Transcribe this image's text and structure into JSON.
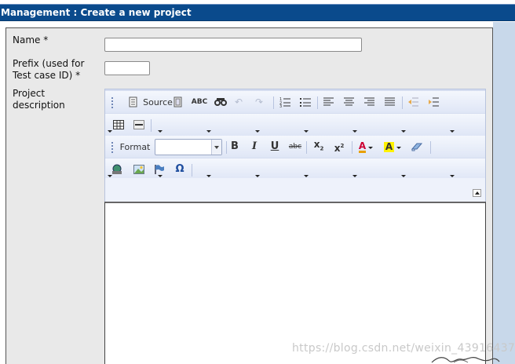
{
  "header": {
    "title": "Management : Create a new project"
  },
  "form": {
    "name_label": "Name *",
    "prefix_label_line1": "Prefix (used for",
    "prefix_label_line2": "Test case ID) *",
    "description_label_line1": "Project",
    "description_label_line2": "description",
    "name_value": "",
    "prefix_value": ""
  },
  "editor": {
    "source_label": "Source",
    "format_label": "Format",
    "format_value": "",
    "icons": [
      "source-icon",
      "templates-icon",
      "spellcheck-icon",
      "find-icon",
      "undo-icon",
      "redo-icon",
      "numbered-list-icon",
      "bulleted-list-icon",
      "align-left-icon",
      "align-center-icon",
      "align-right-icon",
      "justify-icon",
      "outdent-icon",
      "indent-icon",
      "table-icon",
      "horizontal-rule-icon",
      "bold-icon",
      "italic-icon",
      "underline-icon",
      "strikethrough-icon",
      "subscript-icon",
      "superscript-icon",
      "text-color-icon",
      "background-color-icon",
      "eraser-icon",
      "image-icon",
      "flash-icon",
      "anchor-icon",
      "special-char-icon",
      "collapse-icon"
    ]
  },
  "watermark": "https://blog.csdn.net/weixin_43916437",
  "colors": {
    "titlebar": "#0a4a8c",
    "panel": "#e9e9e9",
    "toolbar": "#d5ddf0"
  }
}
